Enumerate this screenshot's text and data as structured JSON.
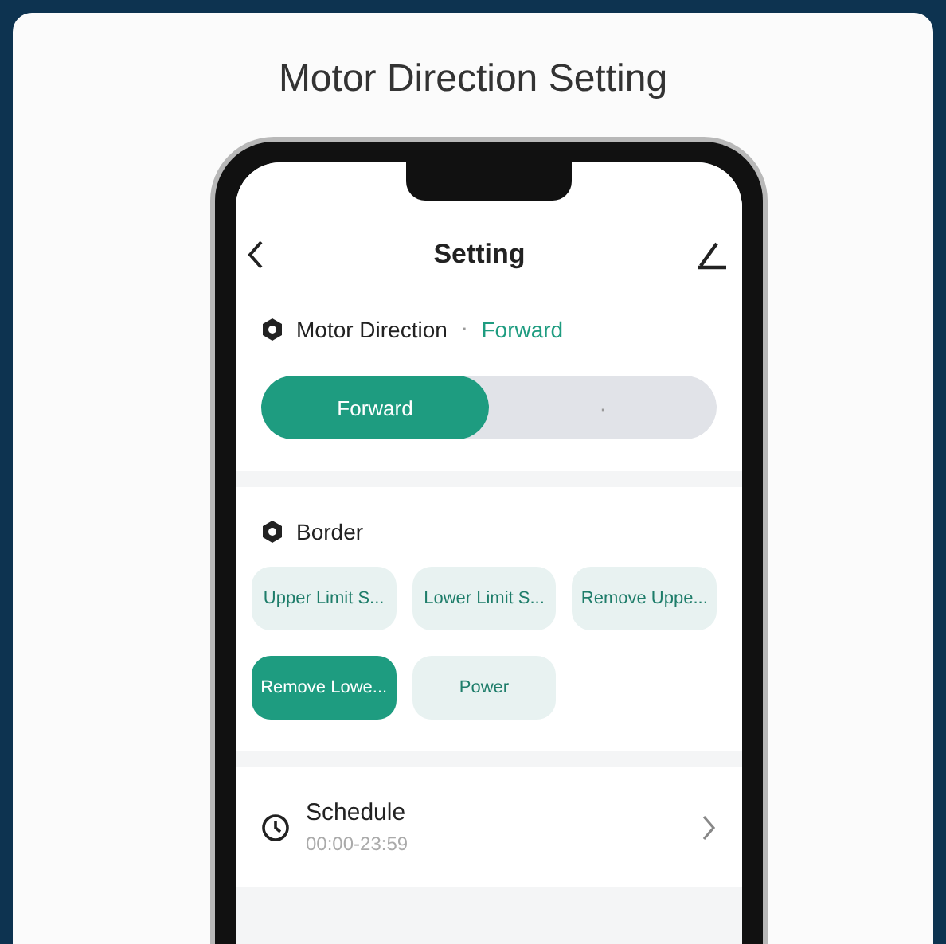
{
  "title": "Motor Direction Setting",
  "app": {
    "header": {
      "title": "Setting"
    },
    "motor_direction": {
      "label": "Motor Direction",
      "separator": "·",
      "value": "Forward",
      "segments": [
        {
          "label": "Forward",
          "selected": true
        },
        {
          "label": "·",
          "selected": false
        }
      ]
    },
    "border": {
      "label": "Border",
      "chips": [
        {
          "label": "Upper Limit S...",
          "selected": false
        },
        {
          "label": "Lower Limit S...",
          "selected": false
        },
        {
          "label": "Remove Uppe...",
          "selected": false
        },
        {
          "label": "Remove Lowe...",
          "selected": true
        },
        {
          "label": "Power",
          "selected": false
        }
      ]
    },
    "schedule": {
      "label": "Schedule",
      "time": "00:00-23:59"
    }
  }
}
